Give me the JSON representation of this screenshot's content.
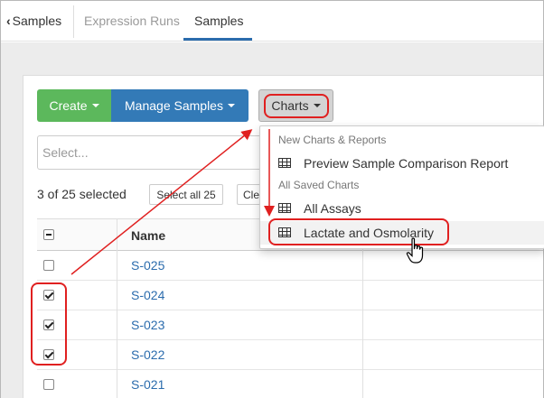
{
  "nav": {
    "back_label": "Samples",
    "tabs": [
      {
        "label": "Expression Runs",
        "active": false
      },
      {
        "label": "Samples",
        "active": true
      }
    ]
  },
  "toolbar": {
    "create_label": "Create",
    "manage_label": "Manage Samples",
    "charts_label": "Charts"
  },
  "filter": {
    "placeholder": "Select..."
  },
  "selection": {
    "count_text": "3 of 25 selected",
    "select_all_label": "Select all 25",
    "clear_label": "Clear"
  },
  "table": {
    "columns": [
      "",
      "Name"
    ],
    "rows": [
      {
        "name": "S-025",
        "checked": false
      },
      {
        "name": "S-024",
        "checked": true
      },
      {
        "name": "S-023",
        "checked": true
      },
      {
        "name": "S-022",
        "checked": true
      },
      {
        "name": "S-021",
        "checked": false
      }
    ]
  },
  "charts_menu": {
    "section_new": "New Charts & Reports",
    "items_new": [
      {
        "label": "Preview Sample Comparison Report",
        "icon": "table-icon"
      }
    ],
    "section_saved": "All Saved Charts",
    "items_saved": [
      {
        "label": "All Assays",
        "icon": "table-icon"
      },
      {
        "label": "Lactate and Osmolarity",
        "icon": "table-icon",
        "highlighted": true
      }
    ]
  },
  "colors": {
    "create": "#5cb85c",
    "manage": "#337ab7",
    "annotation": "#e02020",
    "link": "#2b6cad"
  }
}
